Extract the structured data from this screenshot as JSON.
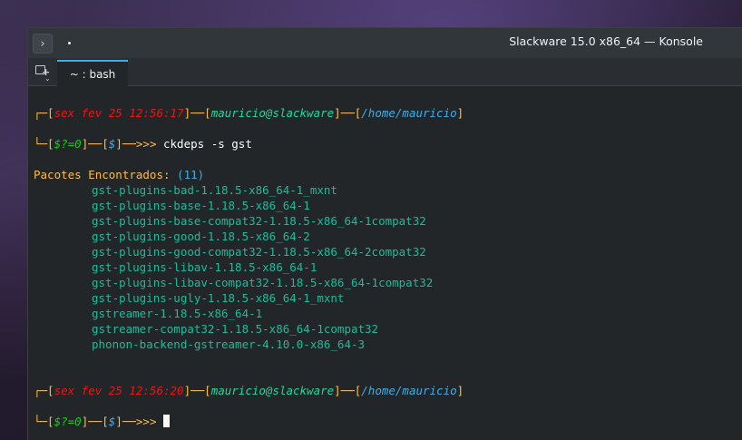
{
  "window": {
    "title": "Slackware 15.0 x86_64 — Konsole",
    "menu_glyph": "›"
  },
  "tabs": [
    {
      "label": "~ : bash"
    }
  ],
  "prompts": [
    {
      "bracket_open": "┌─[",
      "datetime": "sex fev 25 12:56:17",
      "sep1": "]──[",
      "userhost": "mauricio@slackware",
      "sep2": "]──[",
      "path": "/home/mauricio",
      "bracket_close": "]",
      "line2_open": "└─[",
      "status": "$?=0",
      "line2_mid": "]──[",
      "dollar": "$",
      "line2_close": "]──>>>",
      "command": " ckdeps -s gst"
    },
    {
      "bracket_open": "┌─[",
      "datetime": "sex fev 25 12:56:20",
      "sep1": "]──[",
      "userhost": "mauricio@slackware",
      "sep2": "]──[",
      "path": "/home/mauricio",
      "bracket_close": "]",
      "line2_open": "└─[",
      "status": "$?=0",
      "line2_mid": "]──[",
      "dollar": "$",
      "line2_close": "]──>>>",
      "command": " "
    }
  ],
  "output": {
    "heading": "Pacotes Encontrados:",
    "count": "(11)",
    "packages": [
      "gst-plugins-bad-1.18.5-x86_64-1_mxnt",
      "gst-plugins-base-1.18.5-x86_64-1",
      "gst-plugins-base-compat32-1.18.5-x86_64-1compat32",
      "gst-plugins-good-1.18.5-x86_64-2",
      "gst-plugins-good-compat32-1.18.5-x86_64-2compat32",
      "gst-plugins-libav-1.18.5-x86_64-1",
      "gst-plugins-libav-compat32-1.18.5-x86_64-1compat32",
      "gst-plugins-ugly-1.18.5-x86_64-1_mxnt",
      "gstreamer-1.18.5-x86_64-1",
      "gstreamer-compat32-1.18.5-x86_64-1compat32",
      "phonon-backend-gstreamer-4.10.0-x86_64-3"
    ]
  }
}
